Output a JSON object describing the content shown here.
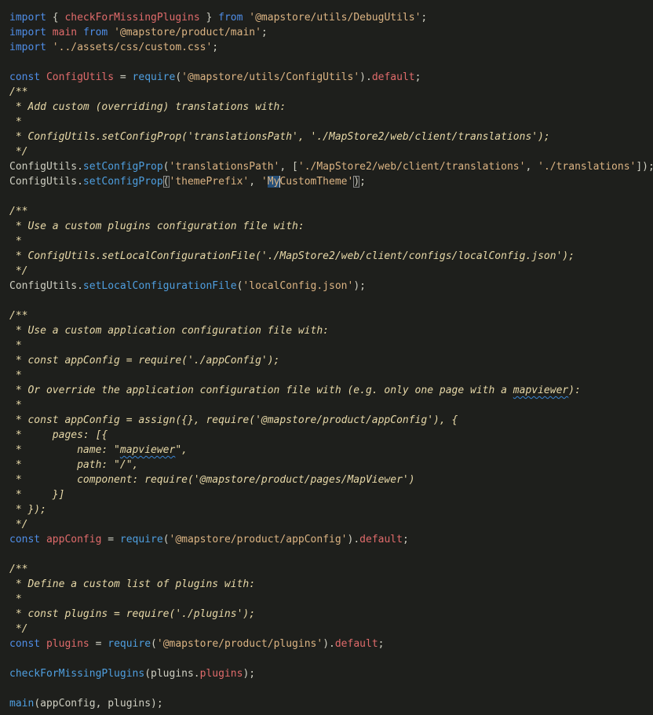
{
  "colors": {
    "background": "#1e1f1c",
    "keyword": "#4f8ee8",
    "function": "#4f9fe0",
    "identifier_red": "#e06b6b",
    "string": "#dcb483",
    "comment": "#e8d9a8",
    "text": "#cfcfc2"
  },
  "lines": [
    [
      {
        "c": "kw",
        "t": "import"
      },
      {
        "c": "tx",
        "t": " { "
      },
      {
        "c": "cls",
        "t": "checkForMissingPlugins"
      },
      {
        "c": "tx",
        "t": " } "
      },
      {
        "c": "kw",
        "t": "from"
      },
      {
        "c": "tx",
        "t": " "
      },
      {
        "c": "str",
        "t": "'@mapstore/utils/DebugUtils'"
      },
      {
        "c": "tx",
        "t": ";"
      }
    ],
    [
      {
        "c": "kw",
        "t": "import"
      },
      {
        "c": "tx",
        "t": " "
      },
      {
        "c": "cls",
        "t": "main"
      },
      {
        "c": "tx",
        "t": " "
      },
      {
        "c": "kw",
        "t": "from"
      },
      {
        "c": "tx",
        "t": " "
      },
      {
        "c": "str",
        "t": "'@mapstore/product/main'"
      },
      {
        "c": "tx",
        "t": ";"
      }
    ],
    [
      {
        "c": "kw",
        "t": "import"
      },
      {
        "c": "tx",
        "t": " "
      },
      {
        "c": "str",
        "t": "'../assets/css/custom.css'"
      },
      {
        "c": "tx",
        "t": ";"
      }
    ],
    [],
    [
      {
        "c": "kw",
        "t": "const"
      },
      {
        "c": "tx",
        "t": " "
      },
      {
        "c": "cls",
        "t": "ConfigUtils"
      },
      {
        "c": "tx",
        "t": " = "
      },
      {
        "c": "fn",
        "t": "require"
      },
      {
        "c": "tx",
        "t": "("
      },
      {
        "c": "str",
        "t": "'@mapstore/utils/ConfigUtils'"
      },
      {
        "c": "tx",
        "t": ")."
      },
      {
        "c": "cls",
        "t": "default"
      },
      {
        "c": "tx",
        "t": ";"
      }
    ],
    [
      {
        "c": "cm",
        "t": "/**"
      }
    ],
    [
      {
        "c": "cm",
        "t": " * Add custom (overriding) translations with:"
      }
    ],
    [
      {
        "c": "cm",
        "t": " *"
      }
    ],
    [
      {
        "c": "cm",
        "t": " * ConfigUtils.setConfigProp('translationsPath', './MapStore2/web/client/translations');"
      }
    ],
    [
      {
        "c": "cm",
        "t": " */"
      }
    ],
    [
      {
        "c": "tx",
        "t": "ConfigUtils."
      },
      {
        "c": "fn",
        "t": "setConfigProp"
      },
      {
        "c": "tx",
        "t": "("
      },
      {
        "c": "str",
        "t": "'translationsPath'"
      },
      {
        "c": "tx",
        "t": ", ["
      },
      {
        "c": "str",
        "t": "'./MapStore2/web/client/translations'"
      },
      {
        "c": "tx",
        "t": ", "
      },
      {
        "c": "str",
        "t": "'./translations'"
      },
      {
        "c": "tx",
        "t": "]);"
      }
    ],
    [
      {
        "c": "tx",
        "t": "ConfigUtils."
      },
      {
        "c": "fn",
        "t": "setConfigProp"
      },
      {
        "c": "tx bracket-box",
        "t": "("
      },
      {
        "c": "str",
        "t": "'themePrefix'"
      },
      {
        "c": "tx",
        "t": ", "
      },
      {
        "c": "str",
        "t": "'"
      },
      {
        "c": "str selected",
        "t": "My"
      },
      {
        "c": "caret",
        "t": ""
      },
      {
        "c": "str",
        "t": "CustomTheme'"
      },
      {
        "c": "tx bracket-box",
        "t": ")"
      },
      {
        "c": "tx",
        "t": ";"
      }
    ],
    [],
    [
      {
        "c": "cm",
        "t": "/**"
      }
    ],
    [
      {
        "c": "cm",
        "t": " * Use a custom plugins configuration file with:"
      }
    ],
    [
      {
        "c": "cm",
        "t": " *"
      }
    ],
    [
      {
        "c": "cm",
        "t": " * ConfigUtils.setLocalConfigurationFile('./MapStore2/web/client/configs/localConfig.json');"
      }
    ],
    [
      {
        "c": "cm",
        "t": " */"
      }
    ],
    [
      {
        "c": "tx",
        "t": "ConfigUtils."
      },
      {
        "c": "fn",
        "t": "setLocalConfigurationFile"
      },
      {
        "c": "tx",
        "t": "("
      },
      {
        "c": "str",
        "t": "'localConfig.json'"
      },
      {
        "c": "tx",
        "t": ");"
      }
    ],
    [],
    [
      {
        "c": "cm",
        "t": "/**"
      }
    ],
    [
      {
        "c": "cm",
        "t": " * Use a custom application configuration file with:"
      }
    ],
    [
      {
        "c": "cm",
        "t": " *"
      }
    ],
    [
      {
        "c": "cm",
        "t": " * const appConfig = require('./appConfig');"
      }
    ],
    [
      {
        "c": "cm",
        "t": " *"
      }
    ],
    [
      {
        "c": "cm",
        "t": " * Or override the application configuration file with (e.g. only one page with a "
      },
      {
        "c": "cm squiggle",
        "t": "mapviewer"
      },
      {
        "c": "cm",
        "t": "):"
      }
    ],
    [
      {
        "c": "cm",
        "t": " *"
      }
    ],
    [
      {
        "c": "cm",
        "t": " * const appConfig = assign({}, require('@mapstore/product/appConfig'), {"
      }
    ],
    [
      {
        "c": "cm",
        "t": " *     pages: [{"
      }
    ],
    [
      {
        "c": "cm",
        "t": " *         name: \""
      },
      {
        "c": "cm squiggle",
        "t": "mapviewer"
      },
      {
        "c": "cm",
        "t": "\","
      }
    ],
    [
      {
        "c": "cm",
        "t": " *         path: \"/\","
      }
    ],
    [
      {
        "c": "cm",
        "t": " *         component: require('@mapstore/product/pages/MapViewer')"
      }
    ],
    [
      {
        "c": "cm",
        "t": " *     }]"
      }
    ],
    [
      {
        "c": "cm",
        "t": " * });"
      }
    ],
    [
      {
        "c": "cm",
        "t": " */"
      }
    ],
    [
      {
        "c": "kw",
        "t": "const"
      },
      {
        "c": "tx",
        "t": " "
      },
      {
        "c": "cls",
        "t": "appConfig"
      },
      {
        "c": "tx",
        "t": " = "
      },
      {
        "c": "fn",
        "t": "require"
      },
      {
        "c": "tx",
        "t": "("
      },
      {
        "c": "str",
        "t": "'@mapstore/product/appConfig'"
      },
      {
        "c": "tx",
        "t": ")."
      },
      {
        "c": "cls",
        "t": "default"
      },
      {
        "c": "tx",
        "t": ";"
      }
    ],
    [],
    [
      {
        "c": "cm",
        "t": "/**"
      }
    ],
    [
      {
        "c": "cm",
        "t": " * Define a custom list of plugins with:"
      }
    ],
    [
      {
        "c": "cm",
        "t": " *"
      }
    ],
    [
      {
        "c": "cm",
        "t": " * const plugins = require('./plugins');"
      }
    ],
    [
      {
        "c": "cm",
        "t": " */"
      }
    ],
    [
      {
        "c": "kw",
        "t": "const"
      },
      {
        "c": "tx",
        "t": " "
      },
      {
        "c": "cls",
        "t": "plugins"
      },
      {
        "c": "tx",
        "t": " = "
      },
      {
        "c": "fn",
        "t": "require"
      },
      {
        "c": "tx",
        "t": "("
      },
      {
        "c": "str",
        "t": "'@mapstore/product/plugins'"
      },
      {
        "c": "tx",
        "t": ")."
      },
      {
        "c": "cls",
        "t": "default"
      },
      {
        "c": "tx",
        "t": ";"
      }
    ],
    [],
    [
      {
        "c": "fn",
        "t": "checkForMissingPlugins"
      },
      {
        "c": "tx",
        "t": "(plugins."
      },
      {
        "c": "cls",
        "t": "plugins"
      },
      {
        "c": "tx",
        "t": ");"
      }
    ],
    [],
    [
      {
        "c": "fn",
        "t": "main"
      },
      {
        "c": "tx",
        "t": "(appConfig, plugins);"
      }
    ]
  ]
}
